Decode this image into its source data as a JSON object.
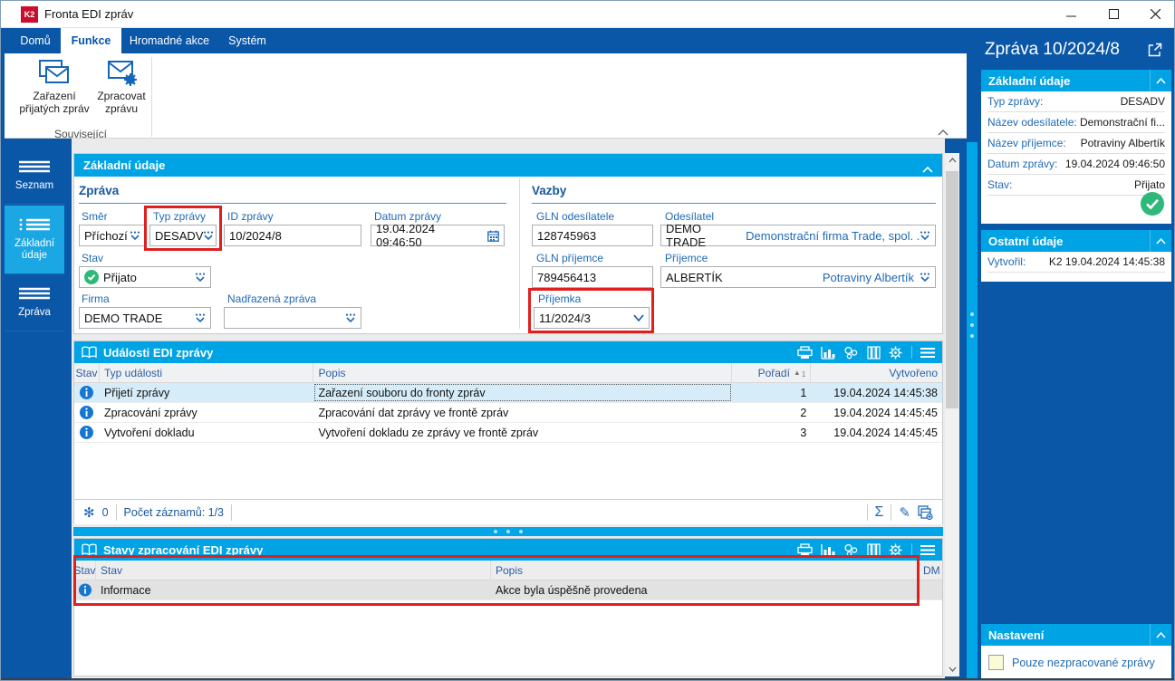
{
  "window": {
    "title": "Fronta EDI zpráv",
    "logo": "K2"
  },
  "tabs": [
    {
      "label": "Domů"
    },
    {
      "label": "Funkce"
    },
    {
      "label": "Hromadné akce"
    },
    {
      "label": "Systém"
    }
  ],
  "ribbon": {
    "buttons": [
      {
        "label": "Zařazení přijatých zpráv"
      },
      {
        "label": "Zpracovat zprávu"
      }
    ],
    "group": "Související"
  },
  "sidebar": [
    {
      "label": "Seznam"
    },
    {
      "label": "Základní údaje"
    },
    {
      "label": "Zpráva"
    }
  ],
  "form": {
    "panel_title": "Základní údaje",
    "group_zprava": "Zpráva",
    "group_vazby": "Vazby",
    "smer": {
      "label": "Směr",
      "value": "Příchozí"
    },
    "typ": {
      "label": "Typ zprávy",
      "value": "DESADV"
    },
    "id": {
      "label": "ID zprávy",
      "value": "10/2024/8"
    },
    "datum": {
      "label": "Datum zprávy",
      "value": "19.04.2024 09:46:50"
    },
    "stav": {
      "label": "Stav",
      "value": "Přijato"
    },
    "firma": {
      "label": "Firma",
      "value": "DEMO TRADE"
    },
    "nadrazena": {
      "label": "Nadřazená zpráva",
      "value": ""
    },
    "gln_odesilatele": {
      "label": "GLN odesílatele",
      "value": "128745963"
    },
    "odesilatel": {
      "label": "Odesílatel",
      "value": "DEMO TRADE",
      "detail": "Demonstrační firma Trade, spol. ..."
    },
    "gln_prijemce": {
      "label": "GLN příjemce",
      "value": "789456413"
    },
    "prijemce": {
      "label": "Příjemce",
      "value": "ALBERTÍK",
      "detail": "Potraviny Albertík"
    },
    "prijemka": {
      "label": "Příjemka",
      "value": "11/2024/3"
    }
  },
  "events": {
    "title": "Události EDI zprávy",
    "columns": {
      "stav": "Stav",
      "typ": "Typ události",
      "popis": "Popis",
      "poradi": "Pořadí",
      "vytvoreno": "Vytvořeno"
    },
    "sort": {
      "arrow": "▲",
      "num": "1"
    },
    "rows": [
      {
        "typ": "Přijetí zprávy",
        "popis": "Zařazení souboru do fronty zpráv",
        "poradi": "1",
        "vytvoreno": "19.04.2024 14:45:38"
      },
      {
        "typ": "Zpracování zprávy",
        "popis": "Zpracování dat zprávy ve frontě zpráv",
        "poradi": "2",
        "vytvoreno": "19.04.2024 14:45:45"
      },
      {
        "typ": "Vytvoření dokladu",
        "popis": "Vytvoření dokladu ze zprávy ve frontě zpráv",
        "poradi": "3",
        "vytvoreno": "19.04.2024 14:45:45"
      }
    ],
    "footer": {
      "count": "0",
      "records": "Počet záznamů: 1/3",
      "sum_icon": "Σ",
      "edit_icon": "✎",
      "filter_icon": "✻"
    }
  },
  "states": {
    "title": "Stavy zpracování EDI zprávy",
    "columns": {
      "stav_icon": "Stav",
      "stav": "Stav",
      "popis": "Popis",
      "dm": "DM"
    },
    "rows": [
      {
        "stav": "Informace",
        "popis": "Akce byla úspěšně provedena"
      }
    ]
  },
  "panel": {
    "title": "Zpráva 10/2024/8",
    "zakladni": {
      "title": "Základní údaje",
      "rows": [
        {
          "label": "Typ zprávy:",
          "value": "DESADV"
        },
        {
          "label": "Název odesílatele:",
          "value": "Demonstrační fi..."
        },
        {
          "label": "Název příjemce:",
          "value": "Potraviny Albertík"
        },
        {
          "label": "Datum zprávy:",
          "value": "19.04.2024 09:46:50"
        },
        {
          "label": "Stav:",
          "value": "Přijato"
        }
      ]
    },
    "ostatni": {
      "title": "Ostatní údaje",
      "rows": [
        {
          "label": "Vytvořil:",
          "value": "K2 19.04.2024 14:45:38"
        }
      ]
    },
    "nastaveni": {
      "title": "Nastavení",
      "checkbox_label": "Pouze nezpracované zprávy"
    }
  },
  "colors": {
    "dark_blue": "#0a57a8",
    "cyan": "#00a3e4",
    "label_blue": "#1f69b4",
    "red_highlight": "#e01f1f",
    "green": "#2eb879",
    "selected_row": "#d6edf9"
  }
}
